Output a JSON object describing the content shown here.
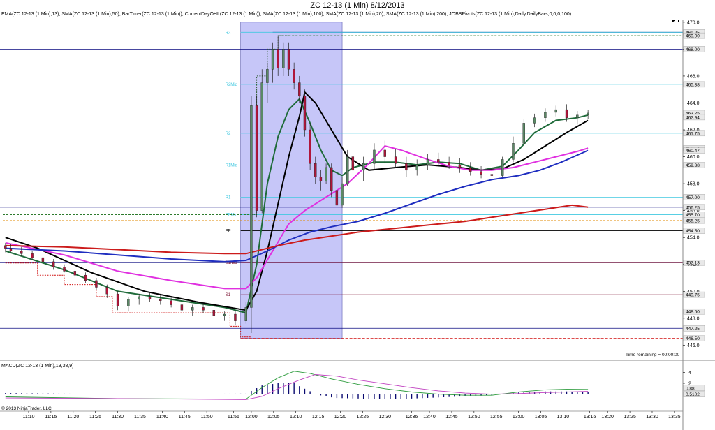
{
  "title": "ZC 12-13 (1 Min)  8/12/2013",
  "indicator_line": "EMA(ZC 12-13 (1 Min),13), SMA(ZC 12-13 (1 Min),50), BarTimer(ZC 12-13 (1 Min)), CurrentDayOHL(ZC 12-13 (1 Min)), SMA(ZC 12-13 (1 Min),100), SMA(ZC 12-13 (1 Min),20), SMA(ZC 12-13 (1 Min),200), JOBBPivots(ZC 12-13 (1 Min),Daily,DailyBars,0,0,0,100)",
  "time_remaining": "Time remaining = 00:00:00",
  "copyright": "© 2013 NinjaTrader, LLC",
  "macd_label": "MACD(ZC 12-13 (1 Min),19,38,9)",
  "colors": {
    "up": "#5a8a66",
    "down": "#b0153a",
    "ema13": "#1f6b3a",
    "sma50": "#000000",
    "sma100": "#1f2ec0",
    "sma20": "#e030e0",
    "sma200": "#cc1b1b",
    "highlight": "#8080f0",
    "pivot_cyan": "#40c8e0",
    "pivot_black": "#000000",
    "pivot_darkred": "#7a1030"
  },
  "chart_data": {
    "type": "candlestick",
    "x_ticks": [
      "11:10",
      "11:15",
      "11:20",
      "11:25",
      "11:30",
      "11:35",
      "11:40",
      "11:45",
      "11:50",
      "11:56",
      "12:00",
      "12:05",
      "12:10",
      "12:15",
      "12:20",
      "12:25",
      "12:30",
      "12:36",
      "12:40",
      "12:45",
      "12:50",
      "12:55",
      "13:00",
      "13:05",
      "13:10",
      "13:16",
      "13:20",
      "13:25",
      "13:30",
      "13:35"
    ],
    "y_ticks": [
      446.0,
      448.0,
      450.0,
      452.0,
      454.0,
      456.0,
      458.0,
      460.0,
      462.0,
      464.0,
      466.0,
      468.0,
      470.0
    ],
    "ylim": [
      445.5,
      470.2
    ],
    "price_labels": [
      {
        "text": "469.25",
        "value": 469.25
      },
      {
        "text": "469.00",
        "value": 469.0
      },
      {
        "text": "468.00",
        "value": 468.0
      },
      {
        "text": "465.38",
        "value": 465.38
      },
      {
        "text": "463.25",
        "value": 463.25
      },
      {
        "text": "462.94",
        "value": 462.94
      },
      {
        "text": "461.75",
        "value": 461.75
      },
      {
        "text": "460.64",
        "value": 460.64
      },
      {
        "text": "460.47",
        "value": 460.47
      },
      {
        "text": "459.38",
        "value": 459.38
      },
      {
        "text": "457.00",
        "value": 457.0
      },
      {
        "text": "456.25",
        "value": 456.25
      },
      {
        "text": "455.70",
        "value": 455.7
      },
      {
        "text": "455.25",
        "value": 455.25
      },
      {
        "text": "454.50",
        "value": 454.5
      },
      {
        "text": "452.13",
        "value": 452.13
      },
      {
        "text": "449.75",
        "value": 449.75
      },
      {
        "text": "448.50",
        "value": 448.5
      },
      {
        "text": "447.25",
        "value": 447.25
      },
      {
        "text": "446.50",
        "value": 446.5
      }
    ],
    "pivots": [
      {
        "name": "R3",
        "value": 469.25,
        "color": "cyan"
      },
      {
        "name": "R2Mid",
        "value": 465.38,
        "color": "cyan"
      },
      {
        "name": "R2",
        "value": 461.75,
        "color": "cyan"
      },
      {
        "name": "R1Mid",
        "value": 459.38,
        "color": "cyan"
      },
      {
        "name": "R1",
        "value": 457.0,
        "color": "cyan"
      },
      {
        "name": "PPMid",
        "value": 455.7,
        "color": "cyan"
      },
      {
        "name": "PP",
        "value": 454.5,
        "color": "black"
      },
      {
        "name": "S1Mid",
        "value": 452.13,
        "color": "darkred"
      },
      {
        "name": "S1",
        "value": 449.75,
        "color": "darkred"
      }
    ],
    "candles": [
      [
        11.08,
        453.4,
        453.6,
        452.9,
        453.2
      ],
      [
        11.1,
        453.2,
        453.5,
        452.9,
        453.0
      ],
      [
        11.14,
        453.0,
        453.3,
        452.6,
        452.8
      ],
      [
        11.18,
        452.8,
        453.0,
        452.3,
        452.5
      ],
      [
        11.22,
        452.5,
        452.7,
        452.0,
        452.2
      ],
      [
        11.26,
        452.2,
        452.4,
        451.6,
        451.8
      ],
      [
        11.3,
        451.8,
        452.0,
        451.4,
        451.5
      ],
      [
        11.34,
        451.5,
        451.7,
        451.0,
        451.2
      ],
      [
        11.38,
        451.2,
        451.4,
        450.6,
        450.8
      ],
      [
        11.42,
        450.8,
        451.0,
        450.1,
        450.3
      ],
      [
        11.46,
        450.3,
        450.5,
        449.5,
        449.8
      ],
      [
        11.5,
        449.8,
        450.0,
        448.6,
        448.9
      ],
      [
        11.54,
        448.9,
        449.6,
        448.5,
        449.4
      ],
      [
        11.58,
        449.4,
        449.8,
        449.0,
        449.6
      ],
      [
        11.62,
        449.6,
        449.9,
        449.2,
        449.4
      ],
      [
        11.66,
        449.4,
        449.7,
        449.0,
        449.3
      ],
      [
        11.7,
        449.3,
        449.6,
        448.8,
        449.0
      ],
      [
        11.74,
        449.0,
        449.3,
        448.4,
        448.6
      ],
      [
        11.78,
        448.6,
        449.0,
        448.2,
        448.8
      ],
      [
        11.82,
        448.8,
        449.2,
        448.4,
        448.6
      ],
      [
        11.86,
        448.6,
        448.9,
        448.0,
        448.2
      ],
      [
        11.9,
        448.2,
        448.5,
        447.8,
        448.3
      ],
      [
        11.94,
        448.3,
        448.6,
        447.5,
        447.8
      ],
      [
        11.98,
        447.8,
        449.2,
        447.6,
        448.8
      ],
      [
        12.0,
        448.8,
        464.5,
        446.9,
        463.8
      ],
      [
        12.02,
        463.8,
        464.5,
        455.5,
        456.0
      ],
      [
        12.04,
        456.0,
        466.5,
        455.8,
        465.5
      ],
      [
        12.06,
        465.5,
        467.0,
        464.0,
        466.5
      ],
      [
        12.08,
        466.5,
        468.5,
        465.5,
        468.0
      ],
      [
        12.1,
        468.0,
        469.0,
        466.0,
        466.6
      ],
      [
        12.12,
        466.6,
        468.5,
        466.0,
        468.0
      ],
      [
        12.14,
        468.0,
        468.5,
        466.0,
        466.5
      ],
      [
        12.16,
        466.5,
        467.0,
        465.0,
        465.5
      ],
      [
        12.18,
        465.5,
        466.0,
        464.0,
        464.5
      ],
      [
        12.2,
        464.5,
        465.0,
        461.5,
        462.0
      ],
      [
        12.22,
        462.0,
        462.5,
        459.0,
        459.5
      ],
      [
        12.24,
        459.5,
        460.0,
        458.0,
        458.5
      ],
      [
        12.26,
        458.5,
        459.0,
        457.5,
        458.2
      ],
      [
        12.28,
        458.2,
        459.5,
        458.0,
        459.2
      ],
      [
        12.3,
        459.2,
        459.5,
        457.0,
        457.5
      ],
      [
        12.32,
        457.5,
        458.0,
        456.0,
        456.4
      ],
      [
        12.34,
        456.4,
        458.5,
        456.2,
        458.0
      ],
      [
        12.36,
        458.0,
        460.5,
        457.8,
        460.0
      ],
      [
        12.38,
        460.0,
        460.5,
        458.5,
        459.0
      ],
      [
        12.42,
        459.0,
        460.0,
        458.2,
        459.5
      ],
      [
        12.46,
        459.5,
        461.0,
        459.0,
        460.5
      ],
      [
        12.5,
        460.5,
        461.2,
        459.5,
        460.0
      ],
      [
        12.54,
        460.0,
        460.6,
        459.2,
        459.5
      ],
      [
        12.58,
        459.5,
        460.0,
        458.5,
        459.0
      ],
      [
        12.62,
        459.0,
        459.8,
        458.6,
        459.4
      ],
      [
        12.66,
        459.4,
        460.2,
        459.0,
        459.8
      ],
      [
        12.7,
        459.8,
        460.3,
        459.3,
        459.6
      ],
      [
        12.74,
        459.6,
        460.0,
        459.1,
        459.4
      ],
      [
        12.78,
        459.4,
        459.9,
        458.8,
        459.2
      ],
      [
        12.82,
        459.2,
        459.6,
        458.6,
        458.9
      ],
      [
        12.86,
        458.9,
        459.3,
        458.4,
        458.7
      ],
      [
        12.9,
        458.7,
        459.2,
        458.3,
        458.6
      ],
      [
        12.94,
        458.6,
        460.0,
        458.5,
        459.8
      ],
      [
        12.98,
        459.8,
        461.5,
        459.6,
        461.0
      ],
      [
        13.02,
        461.0,
        462.8,
        460.8,
        462.5
      ],
      [
        13.06,
        462.5,
        463.2,
        462.2,
        462.9
      ],
      [
        13.1,
        462.9,
        463.6,
        462.6,
        463.3
      ],
      [
        13.14,
        463.3,
        463.8,
        463.0,
        463.5
      ],
      [
        13.18,
        463.5,
        463.9,
        462.6,
        462.9
      ],
      [
        13.22,
        462.9,
        463.4,
        462.4,
        463.1
      ],
      [
        13.26,
        463.1,
        463.5,
        462.8,
        463.25
      ]
    ],
    "series": [
      {
        "name": "EMA 13",
        "color_key": "ema13",
        "points": [
          [
            11.08,
            453.0
          ],
          [
            11.3,
            451.6
          ],
          [
            11.5,
            450.0
          ],
          [
            11.7,
            449.4
          ],
          [
            11.9,
            448.8
          ],
          [
            11.98,
            448.4
          ],
          [
            12.02,
            452.0
          ],
          [
            12.06,
            458.0
          ],
          [
            12.1,
            461.5
          ],
          [
            12.14,
            463.5
          ],
          [
            12.18,
            464.3
          ],
          [
            12.22,
            462.5
          ],
          [
            12.26,
            460.5
          ],
          [
            12.3,
            459.0
          ],
          [
            12.34,
            458.6
          ],
          [
            12.38,
            459.2
          ],
          [
            12.46,
            459.6
          ],
          [
            12.54,
            459.6
          ],
          [
            12.62,
            459.4
          ],
          [
            12.7,
            459.6
          ],
          [
            12.78,
            459.5
          ],
          [
            12.86,
            459.0
          ],
          [
            12.94,
            459.3
          ],
          [
            13.0,
            460.5
          ],
          [
            13.06,
            461.8
          ],
          [
            13.14,
            462.7
          ],
          [
            13.22,
            462.9
          ],
          [
            13.26,
            463.1
          ]
        ]
      },
      {
        "name": "SMA 50",
        "color_key": "sma50",
        "points": [
          [
            11.08,
            454.0
          ],
          [
            11.2,
            453.2
          ],
          [
            11.4,
            451.4
          ],
          [
            11.6,
            450.0
          ],
          [
            11.8,
            449.2
          ],
          [
            11.98,
            448.6
          ],
          [
            12.02,
            450.0
          ],
          [
            12.06,
            453.0
          ],
          [
            12.1,
            456.5
          ],
          [
            12.14,
            460.0
          ],
          [
            12.18,
            463.0
          ],
          [
            12.2,
            464.8
          ],
          [
            12.24,
            464.0
          ],
          [
            12.3,
            462.0
          ],
          [
            12.36,
            460.0
          ],
          [
            12.44,
            459.0
          ],
          [
            12.54,
            459.2
          ],
          [
            12.66,
            459.4
          ],
          [
            12.78,
            459.2
          ],
          [
            12.86,
            459.0
          ],
          [
            12.94,
            459.1
          ],
          [
            13.02,
            459.8
          ],
          [
            13.1,
            460.8
          ],
          [
            13.18,
            461.8
          ],
          [
            13.26,
            462.7
          ]
        ]
      },
      {
        "name": "SMA 20",
        "color_key": "sma20",
        "points": [
          [
            11.08,
            453.6
          ],
          [
            11.3,
            452.7
          ],
          [
            11.5,
            451.5
          ],
          [
            11.7,
            450.8
          ],
          [
            11.9,
            450.2
          ],
          [
            11.98,
            450.2
          ],
          [
            12.02,
            451.0
          ],
          [
            12.08,
            453.0
          ],
          [
            12.14,
            455.0
          ],
          [
            12.2,
            456.0
          ],
          [
            12.28,
            457.0
          ],
          [
            12.36,
            458.0
          ],
          [
            12.44,
            459.5
          ],
          [
            12.5,
            460.8
          ],
          [
            12.56,
            460.5
          ],
          [
            12.66,
            459.8
          ],
          [
            12.74,
            459.3
          ],
          [
            12.82,
            459.0
          ],
          [
            12.9,
            459.0
          ],
          [
            12.98,
            459.2
          ],
          [
            13.06,
            459.6
          ],
          [
            13.14,
            460.0
          ],
          [
            13.22,
            460.4
          ],
          [
            13.26,
            460.64
          ]
        ]
      },
      {
        "name": "SMA 100",
        "color_key": "sma100",
        "points": [
          [
            11.08,
            453.2
          ],
          [
            11.3,
            453.0
          ],
          [
            11.5,
            452.7
          ],
          [
            11.7,
            452.4
          ],
          [
            11.9,
            452.2
          ],
          [
            11.98,
            452.3
          ],
          [
            12.06,
            453.0
          ],
          [
            12.14,
            453.8
          ],
          [
            12.22,
            454.4
          ],
          [
            12.3,
            454.8
          ],
          [
            12.4,
            455.2
          ],
          [
            12.5,
            455.8
          ],
          [
            12.6,
            456.5
          ],
          [
            12.7,
            457.2
          ],
          [
            12.8,
            457.8
          ],
          [
            12.9,
            458.3
          ],
          [
            13.0,
            458.6
          ],
          [
            13.08,
            459.0
          ],
          [
            13.16,
            459.6
          ],
          [
            13.26,
            460.47
          ]
        ]
      },
      {
        "name": "SMA 200",
        "color_key": "sma200",
        "points": [
          [
            11.08,
            453.4
          ],
          [
            11.3,
            453.3
          ],
          [
            11.5,
            453.1
          ],
          [
            11.7,
            452.9
          ],
          [
            11.9,
            452.8
          ],
          [
            11.98,
            452.8
          ],
          [
            12.1,
            453.4
          ],
          [
            12.2,
            453.8
          ],
          [
            12.3,
            454.1
          ],
          [
            12.4,
            454.4
          ],
          [
            12.5,
            454.6
          ],
          [
            12.6,
            454.8
          ],
          [
            12.7,
            455.0
          ],
          [
            12.8,
            455.2
          ],
          [
            12.9,
            455.5
          ],
          [
            13.0,
            455.8
          ],
          [
            13.1,
            456.1
          ],
          [
            13.2,
            456.4
          ],
          [
            13.26,
            456.25
          ]
        ]
      }
    ],
    "highlight_range": {
      "x0": 11.96,
      "x1": 12.34,
      "y0": 446.5,
      "y1": 470.0
    }
  },
  "macd_ticks": [
    {
      "text": "4",
      "value": 4
    },
    {
      "text": "2",
      "value": 2
    },
    {
      "text": "0",
      "value": 0
    }
  ],
  "macd_values": [
    {
      "text": "0.88",
      "value": 0.88
    },
    {
      "text": "0.5102",
      "value": 0.51
    }
  ],
  "macd_data": {
    "ylim": [
      -1.2,
      5.2
    ],
    "macd_line": [
      [
        11.08,
        -0.5
      ],
      [
        11.5,
        -0.8
      ],
      [
        11.98,
        -0.9
      ],
      [
        12.04,
        1.2
      ],
      [
        12.1,
        3.0
      ],
      [
        12.16,
        4.2
      ],
      [
        12.22,
        3.8
      ],
      [
        12.3,
        2.8
      ],
      [
        12.4,
        1.8
      ],
      [
        12.5,
        1.0
      ],
      [
        12.6,
        0.4
      ],
      [
        12.7,
        0.0
      ],
      [
        12.8,
        -0.2
      ],
      [
        12.9,
        -0.2
      ],
      [
        13.0,
        0.4
      ],
      [
        13.1,
        0.8
      ],
      [
        13.18,
        0.9
      ],
      [
        13.26,
        0.88
      ]
    ],
    "signal_line": [
      [
        11.08,
        -0.7
      ],
      [
        11.5,
        -0.8
      ],
      [
        11.98,
        -1.0
      ],
      [
        12.04,
        -0.4
      ],
      [
        12.1,
        1.0
      ],
      [
        12.18,
        2.6
      ],
      [
        12.24,
        3.6
      ],
      [
        12.32,
        3.3
      ],
      [
        12.4,
        2.6
      ],
      [
        12.5,
        1.9
      ],
      [
        12.6,
        1.2
      ],
      [
        12.7,
        0.6
      ],
      [
        12.8,
        0.2
      ],
      [
        12.9,
        0.0
      ],
      [
        13.0,
        0.1
      ],
      [
        13.1,
        0.3
      ],
      [
        13.18,
        0.4
      ],
      [
        13.26,
        0.51
      ]
    ]
  }
}
